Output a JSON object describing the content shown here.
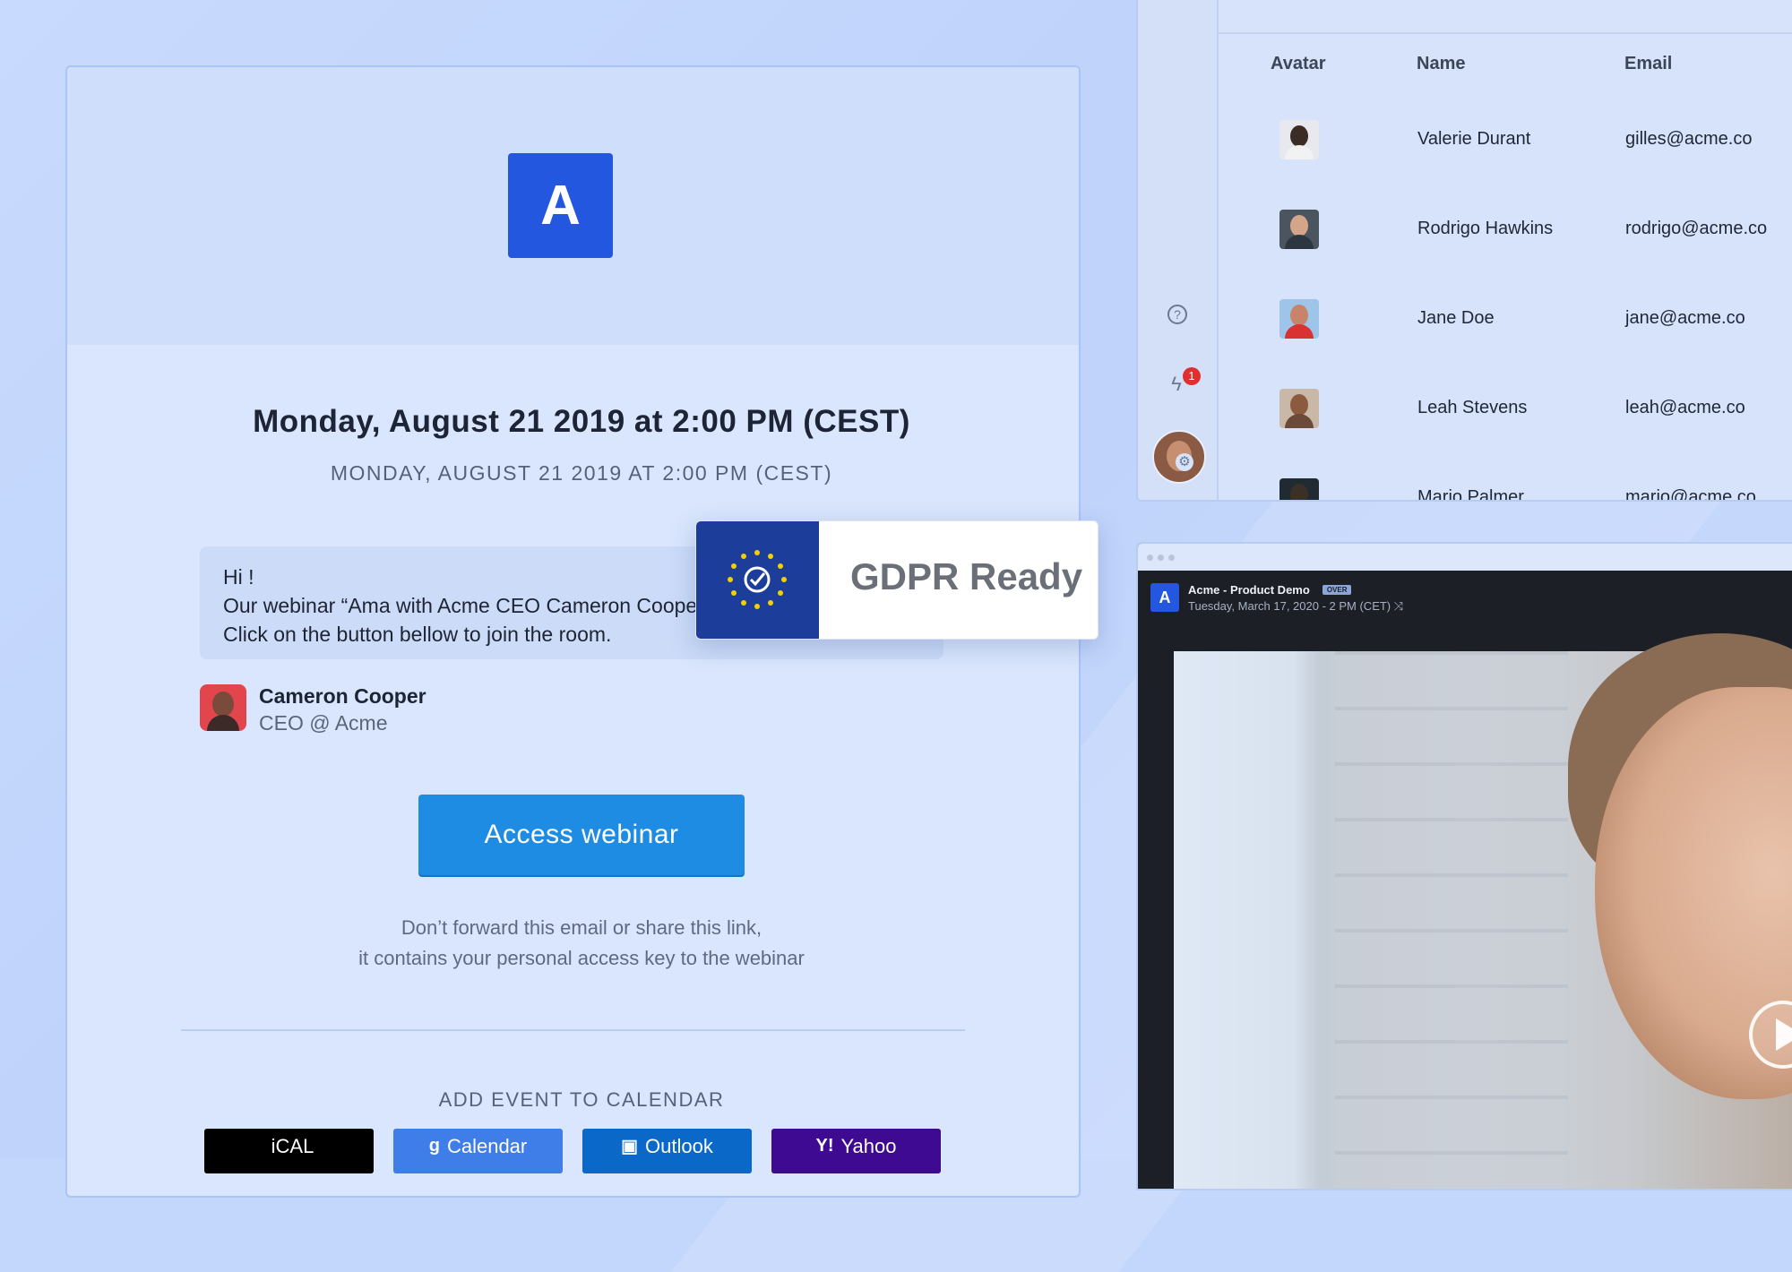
{
  "email": {
    "logo_letter": "A",
    "date_main": "Monday, August 21 2019 at 2:00 PM (CEST)",
    "date_sub": "MONDAY, AUGUST 21 2019 AT 2:00 PM (CEST)",
    "message_lines": [
      "Hi !",
      "Our webinar “Ama with Acme CEO Cameron Coope",
      "Click on the button bellow to join the room."
    ],
    "sender_name": "Cameron Cooper",
    "sender_title": "CEO @ Acme",
    "access_button": "Access webinar",
    "notice_line1": "Don’t forward this email or share this link,",
    "notice_line2": "it contains your personal access key to the webinar",
    "calendar_title": "ADD EVENT TO CALENDAR",
    "calendar_buttons": [
      {
        "label": "iCAL",
        "icon": "apple-icon",
        "color": "#000000"
      },
      {
        "label": "Calendar",
        "icon": "google-icon",
        "color": "#3f7ee8"
      },
      {
        "label": "Outlook",
        "icon": "outlook-icon",
        "color": "#0a68c9"
      },
      {
        "label": "Yahoo",
        "icon": "yahoo-icon",
        "color": "#3d0a91"
      }
    ]
  },
  "gdpr": {
    "label": "GDPR Ready",
    "icon": "eu-stars-check-icon"
  },
  "contacts": {
    "columns": [
      "Avatar",
      "Name",
      "Email"
    ],
    "rows": [
      {
        "name": "Valerie Durant",
        "email": "gilles@acme.co"
      },
      {
        "name": "Rodrigo Hawkins",
        "email": "rodrigo@acme.co"
      },
      {
        "name": "Jane Doe",
        "email": "jane@acme.co"
      },
      {
        "name": "Leah Stevens",
        "email": "leah@acme.co"
      },
      {
        "name": "Mario Palmer",
        "email": "mario@acme.co"
      }
    ],
    "notification_count": "1"
  },
  "video": {
    "logo_letter": "A",
    "title": "Acme - Product Demo",
    "status_badge": "OVER",
    "date": "Tuesday, March 17, 2020 - 2 PM (CET)"
  }
}
